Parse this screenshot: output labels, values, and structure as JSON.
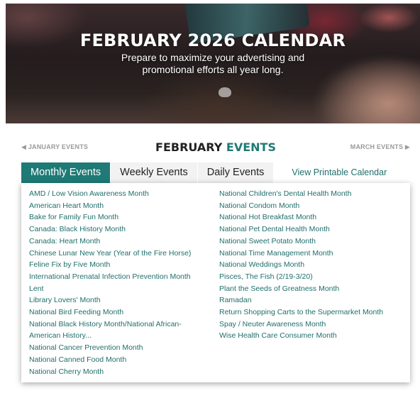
{
  "hero": {
    "title": "FEBRUARY 2026 CALENDAR",
    "subtitle_line1": "Prepare to maximize your advertising and",
    "subtitle_line2": "promotional efforts all year long."
  },
  "nav": {
    "prev": "◀ JANUARY EVENTS",
    "month_word": "FEBRUARY",
    "events_word": "EVENTS",
    "next": "MARCH EVENTS ▶"
  },
  "tabs": {
    "monthly": "Monthly Events",
    "weekly": "Weekly Events",
    "daily": "Daily Events",
    "printable": "View Printable Calendar"
  },
  "events_left": [
    "AMD / Low Vision Awareness Month",
    "American Heart Month",
    "Bake for Family Fun Month",
    "Canada: Black History Month",
    "Canada: Heart Month",
    "Chinese Lunar New Year (Year of the Fire Horse)",
    "Feline Fix by Five Month",
    "International Prenatal Infection Prevention Month",
    "Lent",
    "Library Lovers' Month",
    "National Bird Feeding Month",
    "National Black History Month/National African-American History...",
    "National Cancer Prevention Month",
    "National Canned Food Month",
    "National Cherry Month"
  ],
  "events_right": [
    "National Children's Dental Health Month",
    "National Condom Month",
    "National Hot Breakfast Month",
    "National Pet Dental Health Month",
    "National Sweet Potato Month",
    "National Time Management Month",
    "National Weddings Month",
    "Pisces, The Fish (2/19-3/20)",
    "Plant the Seeds of Greatness Month",
    "Ramadan",
    "Return Shopping Carts to the Supermarket Month",
    "Spay / Neuter Awareness Month",
    "Wise Health Care Consumer Month"
  ]
}
